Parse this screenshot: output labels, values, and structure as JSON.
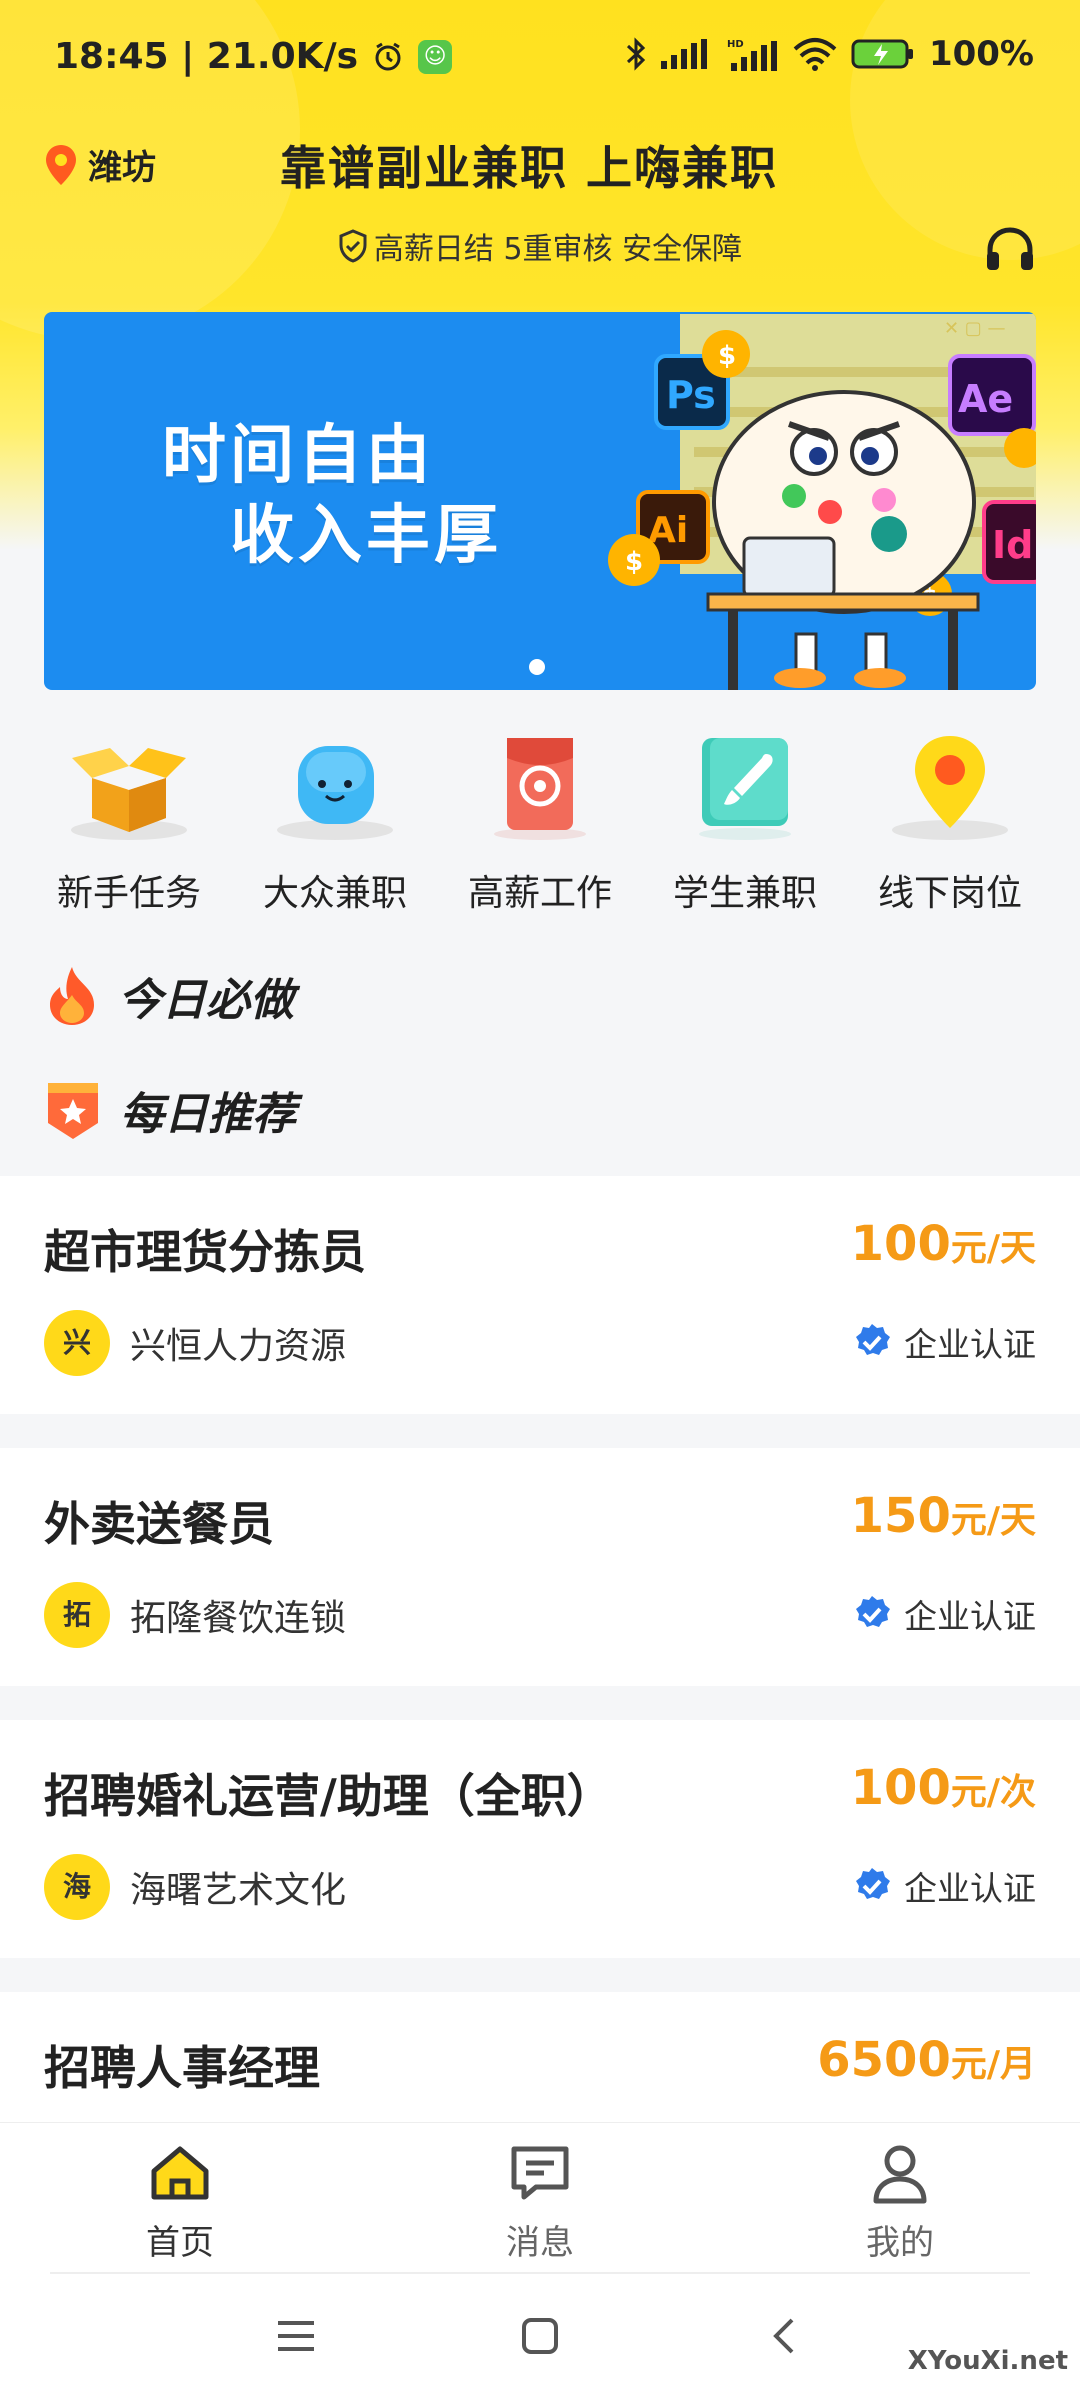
{
  "status_bar": {
    "time": "18:45 | 21.0K/s",
    "battery": "100%"
  },
  "header": {
    "location": "潍坊",
    "title": "靠谱副业兼职 上嗨兼职",
    "slogan": "高薪日结 5重审核 安全保障"
  },
  "banner": {
    "line1": "时间自由",
    "line2": "收入丰厚"
  },
  "quick_entries": [
    {
      "label": "新手任务",
      "icon": "open-box-icon"
    },
    {
      "label": "大众兼职",
      "icon": "smiley-icon"
    },
    {
      "label": "高薪工作",
      "icon": "red-envelope-icon"
    },
    {
      "label": "学生兼职",
      "icon": "brush-icon"
    },
    {
      "label": "线下岗位",
      "icon": "map-pin-icon"
    }
  ],
  "sections": {
    "today": "今日必做",
    "daily": "每日推荐"
  },
  "jobs": [
    {
      "title": "超市理货分拣员",
      "salary": "100",
      "unit": "元/天",
      "company": "兴恒人力资源",
      "avatar": "兴",
      "verify": "企业认证"
    },
    {
      "title": "外卖送餐员",
      "salary": "150",
      "unit": "元/天",
      "company": "拓隆餐饮连锁",
      "avatar": "拓",
      "verify": "企业认证"
    },
    {
      "title": "招聘婚礼运营/助理（全职）",
      "salary": "100",
      "unit": "元/次",
      "company": "海曙艺术文化",
      "avatar": "海",
      "verify": "企业认证"
    },
    {
      "title": "招聘人事经理",
      "salary": "6500",
      "unit": "元/月",
      "company": "",
      "avatar": "",
      "verify": ""
    }
  ],
  "tabs": [
    {
      "label": "首页",
      "icon": "home-icon"
    },
    {
      "label": "消息",
      "icon": "message-icon"
    },
    {
      "label": "我的",
      "icon": "user-icon"
    }
  ],
  "watermark": "XYouXi.net",
  "colors": {
    "brand_yellow": "#FFE11F",
    "salary_orange": "#F59A16",
    "banner_blue": "#1C8CF0",
    "verify_blue": "#2F7BEA"
  }
}
